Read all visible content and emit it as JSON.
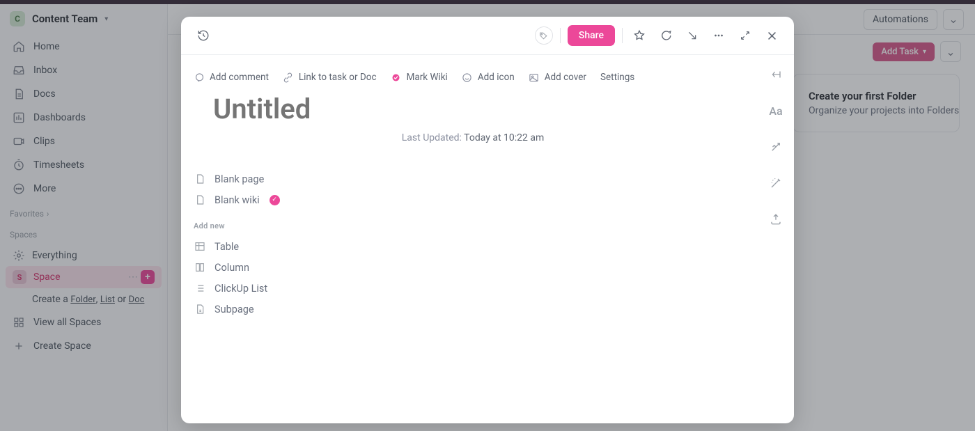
{
  "workspace": {
    "avatar_letter": "C",
    "name": "Content Team"
  },
  "sidebar": {
    "nav": [
      {
        "label": "Home",
        "icon": "home-icon"
      },
      {
        "label": "Inbox",
        "icon": "inbox-icon"
      },
      {
        "label": "Docs",
        "icon": "docs-icon"
      },
      {
        "label": "Dashboards",
        "icon": "dashboards-icon"
      },
      {
        "label": "Clips",
        "icon": "clips-icon"
      },
      {
        "label": "Timesheets",
        "icon": "timesheets-icon"
      },
      {
        "label": "More",
        "icon": "more-icon"
      }
    ],
    "favorites_label": "Favorites",
    "spaces_label": "Spaces",
    "everything_label": "Everything",
    "space": {
      "letter": "S",
      "name": "Space"
    },
    "create_prefix": "Create a ",
    "create_links": {
      "folder": "Folder",
      "list": "List",
      "doc": "Doc"
    },
    "create_or": " or ",
    "view_all_label": "View all Spaces",
    "create_space_label": "Create Space"
  },
  "header": {
    "automations": "Automations",
    "add_task": "Add Task"
  },
  "side_card": {
    "title": "Create your first Folder",
    "subtitle": "Organize your projects into Folders"
  },
  "modal": {
    "share_label": "Share",
    "actions": {
      "add_comment": "Add comment",
      "link_task": "Link to task or Doc",
      "mark_wiki": "Mark Wiki",
      "add_icon": "Add icon",
      "add_cover": "Add cover",
      "settings": "Settings"
    },
    "title_placeholder": "Untitled",
    "updated_label": "Last Updated:",
    "updated_value": "Today at 10:22 am",
    "templates": {
      "blank_page": "Blank page",
      "blank_wiki": "Blank wiki"
    },
    "add_new_label": "Add new",
    "add_new": {
      "table": "Table",
      "column": "Column",
      "clickup_list": "ClickUp List",
      "subpage": "Subpage"
    },
    "rail_text_icon": "Aa"
  }
}
